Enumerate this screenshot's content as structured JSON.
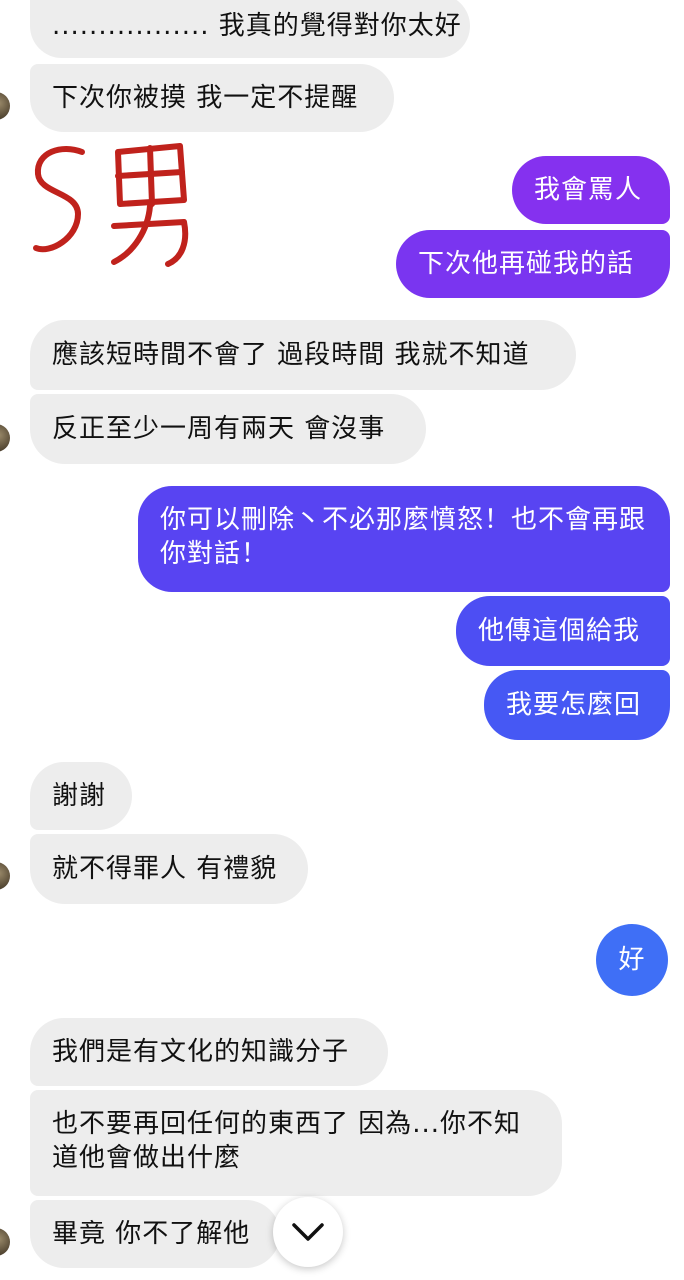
{
  "messages": [
    {
      "id": "m1",
      "side": "in",
      "text": "................. 我真的覺得對你太好"
    },
    {
      "id": "m2",
      "side": "in",
      "text": "下次你被摸 我一定不提醒"
    },
    {
      "id": "m3",
      "side": "out",
      "text": "我會罵人"
    },
    {
      "id": "m4",
      "side": "out",
      "text": "下次他再碰我的話"
    },
    {
      "id": "m5",
      "side": "in",
      "text": "應該短時間不會了 過段時間 我就不知道"
    },
    {
      "id": "m6",
      "side": "in",
      "text": "反正至少一周有兩天 會沒事"
    },
    {
      "id": "m7",
      "side": "out",
      "text": "你可以刪除丶不必那麼憤怒！也不會再跟你對話！"
    },
    {
      "id": "m8",
      "side": "out",
      "text": "他傳這個給我"
    },
    {
      "id": "m9",
      "side": "out",
      "text": "我要怎麼回"
    },
    {
      "id": "m10",
      "side": "in",
      "text": "謝謝"
    },
    {
      "id": "m11",
      "side": "in",
      "text": "就不得罪人 有禮貌"
    },
    {
      "id": "m12",
      "side": "out",
      "text": "好"
    },
    {
      "id": "m13",
      "side": "in",
      "text": "我們是有文化的知識分子"
    },
    {
      "id": "m14",
      "side": "in",
      "text": "也不要再回任何的東西了 因為...你不知道他會做出什麼"
    },
    {
      "id": "m15",
      "side": "in",
      "text": "畢竟 你不了解他"
    }
  ],
  "annotation": {
    "text": "S男",
    "color": "#c0221c"
  },
  "scroll_button": {
    "icon": "chevron-down-icon"
  },
  "colors": {
    "incoming_bubble": "#ededed",
    "outgoing_gradient_top": "#8a32f0",
    "outgoing_gradient_bottom": "#3e6cf6"
  }
}
